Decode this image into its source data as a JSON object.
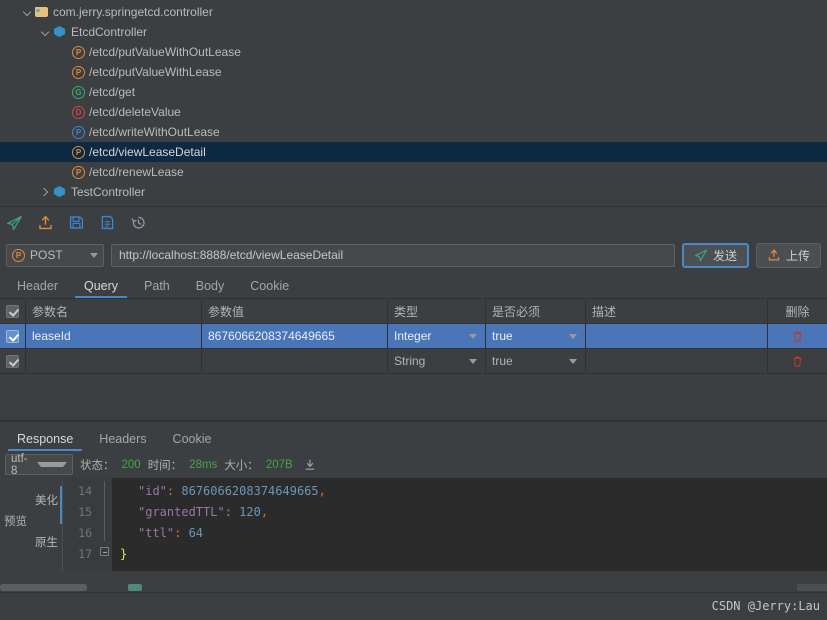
{
  "tree": {
    "rows": [
      {
        "label": "com.jerry.springetcd.controller",
        "icon": "folder-icon",
        "chevron": "expanded",
        "indent": 22,
        "selected": false
      },
      {
        "label": "EtcdController",
        "icon": "class-icon",
        "chevron": "expanded",
        "indent": 40,
        "selected": false
      },
      {
        "label": "/etcd/putValueWithOutLease",
        "icon": "method-badge",
        "badge": "P",
        "badge_color": "#e08a3c",
        "chevron": "none",
        "indent": 72,
        "selected": false
      },
      {
        "label": "/etcd/putValueWithLease",
        "icon": "method-badge",
        "badge": "P",
        "badge_color": "#e08a3c",
        "chevron": "none",
        "indent": 72,
        "selected": false
      },
      {
        "label": "/etcd/get",
        "icon": "method-badge",
        "badge": "G",
        "badge_color": "#3cab6e",
        "chevron": "none",
        "indent": 72,
        "selected": false
      },
      {
        "label": "/etcd/deleteValue",
        "icon": "method-badge",
        "badge": "D",
        "badge_color": "#d6444a",
        "chevron": "none",
        "indent": 72,
        "selected": false
      },
      {
        "label": "/etcd/writeWithOutLease",
        "icon": "method-badge",
        "badge": "P",
        "badge_color": "#3b88d4",
        "chevron": "none",
        "indent": 72,
        "selected": false
      },
      {
        "label": "/etcd/viewLeaseDetail",
        "icon": "method-badge",
        "badge": "P",
        "badge_color": "#e08a3c",
        "chevron": "none",
        "indent": 72,
        "selected": true
      },
      {
        "label": "/etcd/renewLease",
        "icon": "method-badge",
        "badge": "P",
        "badge_color": "#e08a3c",
        "chevron": "none",
        "indent": 72,
        "selected": false
      },
      {
        "label": "TestController",
        "icon": "class-icon",
        "chevron": "collapsed",
        "indent": 40,
        "selected": false
      }
    ]
  },
  "toolbar": {
    "icons": [
      {
        "name": "send-icon",
        "color": "#3fa37a"
      },
      {
        "name": "upload-icon",
        "color": "#e08a3c"
      },
      {
        "name": "save-icon",
        "color": "#3b88d4"
      },
      {
        "name": "document-icon",
        "color": "#3b88d4"
      },
      {
        "name": "history-icon",
        "color": "#9a9a9a"
      }
    ]
  },
  "request": {
    "method": "POST",
    "method_badge": "P",
    "url": "http://localhost:8888/etcd/viewLeaseDetail",
    "url_placeholder": "http://",
    "send_label": "发送",
    "upload_label": "上传",
    "tabs": [
      {
        "label": "Header",
        "active": false
      },
      {
        "label": "Query",
        "active": true
      },
      {
        "label": "Path",
        "active": false
      },
      {
        "label": "Body",
        "active": false
      },
      {
        "label": "Cookie",
        "active": false
      }
    ]
  },
  "param_table": {
    "columns": [
      "参数名",
      "参数值",
      "类型",
      "是否必须",
      "描述",
      "删除"
    ],
    "header_checked": true,
    "rows": [
      {
        "checked": true,
        "name": "leaseId",
        "value": "8676066208374649665",
        "type": "Integer",
        "required": "true",
        "desc": "",
        "selected": true
      },
      {
        "checked": true,
        "name": "",
        "value": "",
        "type": "String",
        "required": "true",
        "desc": "",
        "selected": false
      }
    ]
  },
  "response": {
    "tabs": [
      {
        "label": "Response",
        "active": true
      },
      {
        "label": "Headers",
        "active": false
      },
      {
        "label": "Cookie",
        "active": false
      }
    ],
    "encoding": "utf-8",
    "status_label": "状态：",
    "status_value": "200",
    "time_label": "时间：",
    "time_value": "28ms",
    "size_label": "大小：",
    "size_value": "207B",
    "download_icon": "download-icon",
    "view_tabs": {
      "group_label": "预览",
      "beautify": "美化",
      "raw": "原生"
    },
    "code_lines": [
      {
        "num": "14",
        "key": "\"id\"",
        "sep": ": ",
        "value": "8676066208374649665",
        "tail": ","
      },
      {
        "num": "15",
        "key": "\"grantedTTL\"",
        "sep": ": ",
        "value": "120",
        "tail": ","
      },
      {
        "num": "16",
        "key": "\"ttl\"",
        "sep": ": ",
        "value": "64",
        "tail": ""
      },
      {
        "num": "17",
        "key": "",
        "sep": "",
        "value": "",
        "tail": "}"
      }
    ]
  },
  "footer": {
    "watermark": "CSDN @Jerry:Lau"
  }
}
